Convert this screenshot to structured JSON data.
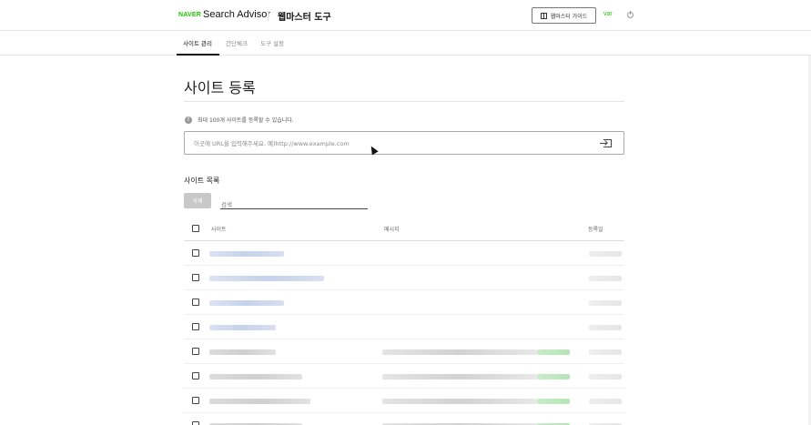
{
  "header": {
    "naver_label": "NAVER",
    "brand": "Search Advisor",
    "tool_title": "웹마스터 도구",
    "guide_button": "웹마스터 가이드",
    "user": "var",
    "colors": {
      "naver_green": "#1ec800"
    }
  },
  "tabs": [
    {
      "label": "사이트 관리",
      "active": true
    },
    {
      "label": "간단체크",
      "active": false
    },
    {
      "label": "도구 설정",
      "active": false
    }
  ],
  "page": {
    "title": "사이트 등록",
    "info_text": "최대 100개 사이트를 등록할 수 있습니다.",
    "url_placeholder": "이곳에 URL을 입력해주세요. 예)http://www.example.com"
  },
  "site_list": {
    "title": "사이트 목록",
    "delete_button": "삭제",
    "search_placeholder": "검색",
    "columns": [
      "사이트",
      "메시지",
      "등록일"
    ],
    "rows": [
      {
        "site_bar_fraction": 0.17,
        "verified": true,
        "message": false
      },
      {
        "site_bar_fraction": 0.26,
        "verified": true,
        "message": false
      },
      {
        "site_bar_fraction": 0.17,
        "verified": true,
        "message": false
      },
      {
        "site_bar_fraction": 0.15,
        "verified": true,
        "message": false
      },
      {
        "site_bar_fraction": 0.15,
        "verified": false,
        "message": true
      },
      {
        "site_bar_fraction": 0.21,
        "verified": false,
        "message": true
      },
      {
        "site_bar_fraction": 0.23,
        "verified": false,
        "message": true
      },
      {
        "site_bar_fraction": 0.21,
        "verified": false,
        "message": true
      }
    ]
  }
}
